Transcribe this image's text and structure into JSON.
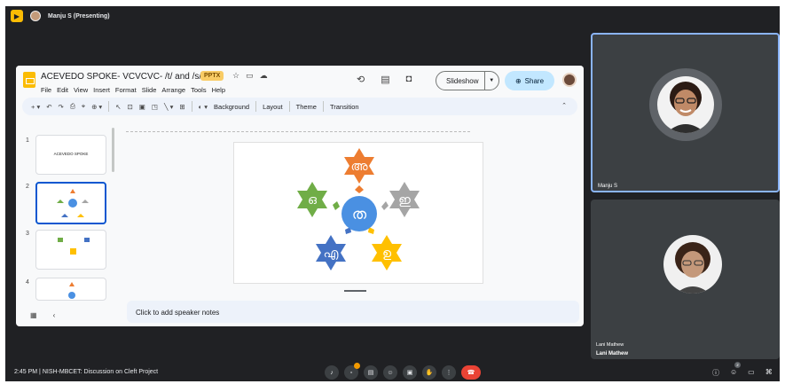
{
  "meet": {
    "presenter_label": "Manju S (Presenting)",
    "time": "2:45 PM",
    "separator": "|",
    "meeting_title": "NISH-MBCET: Discussion on Cleft Project",
    "participant_count": "2"
  },
  "slides_app": {
    "doc_title": "ACEVEDO SPOKE- VCVCVC- /t/ and /s/",
    "file_badge": "PPTX",
    "menu": [
      "File",
      "Edit",
      "View",
      "Insert",
      "Format",
      "Slide",
      "Arrange",
      "Tools",
      "Help"
    ],
    "slideshow_label": "Slideshow",
    "share_label": "Share",
    "toolbar": {
      "background_label": "Background",
      "layout_label": "Layout",
      "theme_label": "Theme",
      "transition_label": "Transition"
    },
    "thumbs": [
      {
        "num": "1",
        "text": "ACEVEDO SPOKE"
      },
      {
        "num": "2",
        "text": ""
      },
      {
        "num": "3",
        "text": ""
      },
      {
        "num": "4",
        "text": ""
      }
    ],
    "notes_placeholder": "Click to add speaker notes"
  },
  "slide_content": {
    "center": "ത",
    "top": "അ",
    "left": "ഒ",
    "right": "ഇ",
    "bottom_left": "എ",
    "bottom_right": "ഉ",
    "colors": {
      "center": "#4a90e2",
      "top": "#ed7d31",
      "left": "#70ad47",
      "right": "#a5a5a5",
      "bottom_left": "#4472c4",
      "bottom_right": "#ffc000"
    }
  },
  "participants": [
    {
      "name": "Manju S"
    },
    {
      "name": "Lani Mathew",
      "name_repeat": "Lani Mathew"
    }
  ],
  "icons": [
    "slides-logo-icon",
    "star-icon",
    "folder-icon",
    "cloud-icon",
    "history-icon",
    "comment-icon",
    "camera-icon",
    "share-icon",
    "microphone-icon",
    "raise-hand-icon",
    "end-call-icon",
    "info-icon",
    "people-icon",
    "chat-icon",
    "activities-icon"
  ]
}
